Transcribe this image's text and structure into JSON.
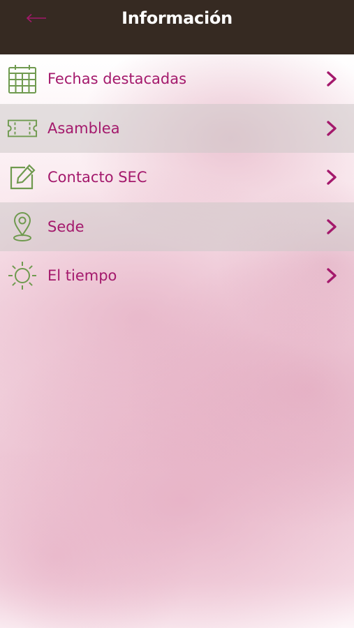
{
  "header": {
    "title": "Información",
    "back_icon": "arrow-left-icon"
  },
  "menu": {
    "items": [
      {
        "label": "Fechas destacadas",
        "icon": "calendar-icon"
      },
      {
        "label": "Asamblea",
        "icon": "ticket-icon"
      },
      {
        "label": "Contacto SEC",
        "icon": "edit-icon"
      },
      {
        "label": "Sede",
        "icon": "location-pin-icon"
      },
      {
        "label": "El tiempo",
        "icon": "sun-icon"
      }
    ],
    "chevron_icon": "chevron-right-icon"
  },
  "colors": {
    "header_bg": "#362a22",
    "label": "#a4196c",
    "icon": "#6f9a4f",
    "back_arrow": "#a4196c"
  }
}
